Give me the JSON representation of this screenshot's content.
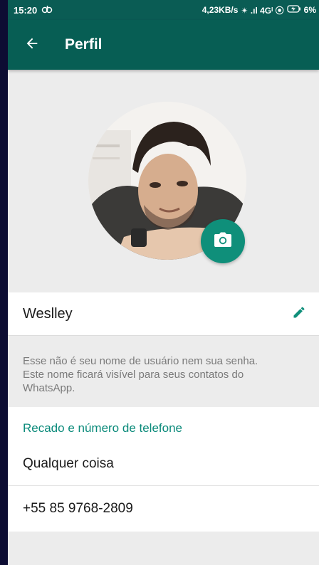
{
  "status_bar": {
    "time": "15:20",
    "left_icon": "notification-icon",
    "network_speed": "4,23KB/s",
    "indicators": "✴ .ıl 4Gᴵ ⦿",
    "battery": "6%"
  },
  "appbar": {
    "back_icon": "arrow-left-icon",
    "title": "Perfil"
  },
  "profile": {
    "photo_description": "profile-photo",
    "camera_icon": "camera-icon",
    "accent_color": "#075e54",
    "fab_color": "#0f8f7a"
  },
  "name": {
    "value": "Weslley",
    "edit_icon": "pencil-icon"
  },
  "hint": "Esse não é seu nome de usuário nem sua senha. Este nome ficará visível para seus contatos do WhatsApp.",
  "about_section": {
    "header": "Recado e número de telefone",
    "status": "Qualquer coisa",
    "phone": "+55 85 9768-2809"
  }
}
